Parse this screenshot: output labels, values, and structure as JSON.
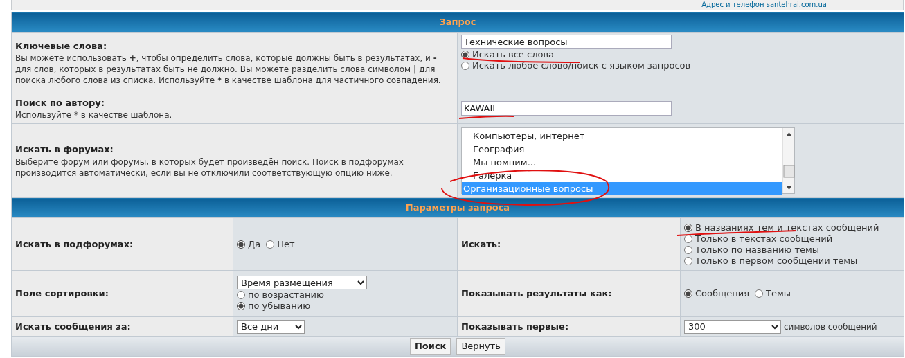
{
  "top_link": "Адрес и телефон santehrai.com.ua",
  "query_section": {
    "title": "Запрос",
    "keywords": {
      "label": "Ключевые слова:",
      "help": "Вы можете использовать **+**, чтобы определить слова, которые должны быть в результатах, и **-** для слов, которых в результатах быть не должно. Вы можете разделить слова символом **|** для поиска любого слова из списка. Используйте ***** в качестве шаблона для частичного совпадения.",
      "value": "Технические вопросы",
      "options": [
        {
          "label": "Искать все слова",
          "selected": true
        },
        {
          "label": "Искать любое слово/поиск с языком запросов",
          "selected": false
        }
      ]
    },
    "author": {
      "label": "Поиск по автору:",
      "help": "Используйте * в качестве шаблона.",
      "value": "KAWAII"
    },
    "forums": {
      "label": "Искать в форумах:",
      "help": "Выберите форум или форумы, в которых будет произведён поиск. Поиск в подфорумах производится автоматически, если вы не отключили соответствующую опцию ниже.",
      "items": [
        {
          "label": "Компьютеры, интернет",
          "selected": false
        },
        {
          "label": "География",
          "selected": false
        },
        {
          "label": "Мы помним...",
          "selected": false
        },
        {
          "label": "Галёрка",
          "selected": false
        },
        {
          "label": "Организационные вопросы",
          "selected": true
        }
      ]
    }
  },
  "params_section": {
    "title": "Параметры запроса",
    "rows": [
      [
        {
          "label": "Искать в подфорумах:",
          "kind": "inline-radios",
          "options": [
            {
              "label": "Да",
              "selected": true
            },
            {
              "label": "Нет",
              "selected": false
            }
          ]
        },
        {
          "label": "Искать:",
          "kind": "stacked-radios",
          "options": [
            {
              "label": "В названиях тем и текстах сообщений",
              "selected": true
            },
            {
              "label": "Только в текстах сообщений",
              "selected": false
            },
            {
              "label": "Только по названию темы",
              "selected": false
            },
            {
              "label": "Только в первом сообщении темы",
              "selected": false
            }
          ]
        }
      ],
      [
        {
          "label": "Поле сортировки:",
          "kind": "select-radios",
          "select": "Время размещения",
          "options": [
            {
              "label": "по возрастанию",
              "selected": false
            },
            {
              "label": "по убыванию",
              "selected": true
            }
          ]
        },
        {
          "label": "Показывать результаты как:",
          "kind": "inline-radios",
          "options": [
            {
              "label": "Сообщения",
              "selected": true
            },
            {
              "label": "Темы",
              "selected": false
            }
          ]
        }
      ],
      [
        {
          "label": "Искать сообщения за:",
          "kind": "select",
          "select": "Все дни"
        },
        {
          "label": "Показывать первые:",
          "kind": "select",
          "select": "300",
          "suffix": "символов сообщений"
        }
      ]
    ]
  },
  "buttons": [
    {
      "label": "Поиск",
      "kind": "primary"
    },
    {
      "label": "Вернуть",
      "kind": "secondary"
    }
  ]
}
